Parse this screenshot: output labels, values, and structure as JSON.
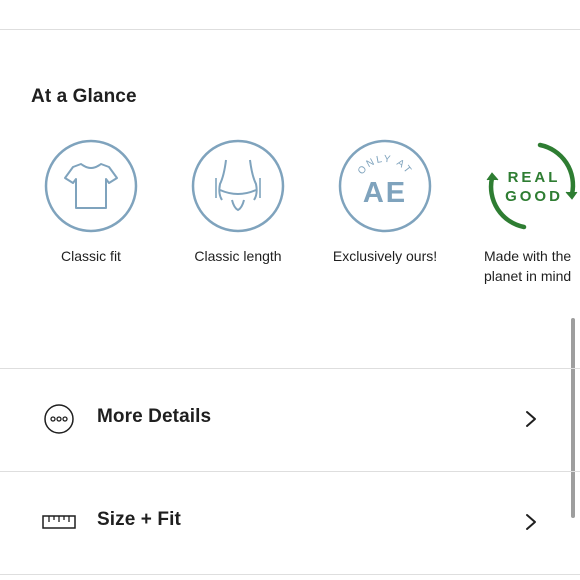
{
  "at_a_glance": {
    "title": "At a Glance",
    "items": [
      {
        "icon": "tshirt-icon",
        "label": "Classic fit"
      },
      {
        "icon": "torso-length-icon",
        "label": "Classic length"
      },
      {
        "icon": "only-at-ae-badge",
        "label": "Exclusively ours!",
        "badge_top": "ONLY AT",
        "badge_main": "AE"
      },
      {
        "icon": "real-good-badge",
        "label_line1": "Made with the",
        "label_line2": "planet in mind",
        "badge_line1": "REAL",
        "badge_line2": "GOOD"
      }
    ]
  },
  "details_rows": [
    {
      "icon": "more-dots-icon",
      "label": "More Details"
    },
    {
      "icon": "ruler-icon",
      "label": "Size + Fit"
    }
  ],
  "colors": {
    "icon_blue": "#7fa3bd",
    "real_good_green": "#2e7d32",
    "text": "#1f1f1f",
    "divider": "#dedede"
  }
}
